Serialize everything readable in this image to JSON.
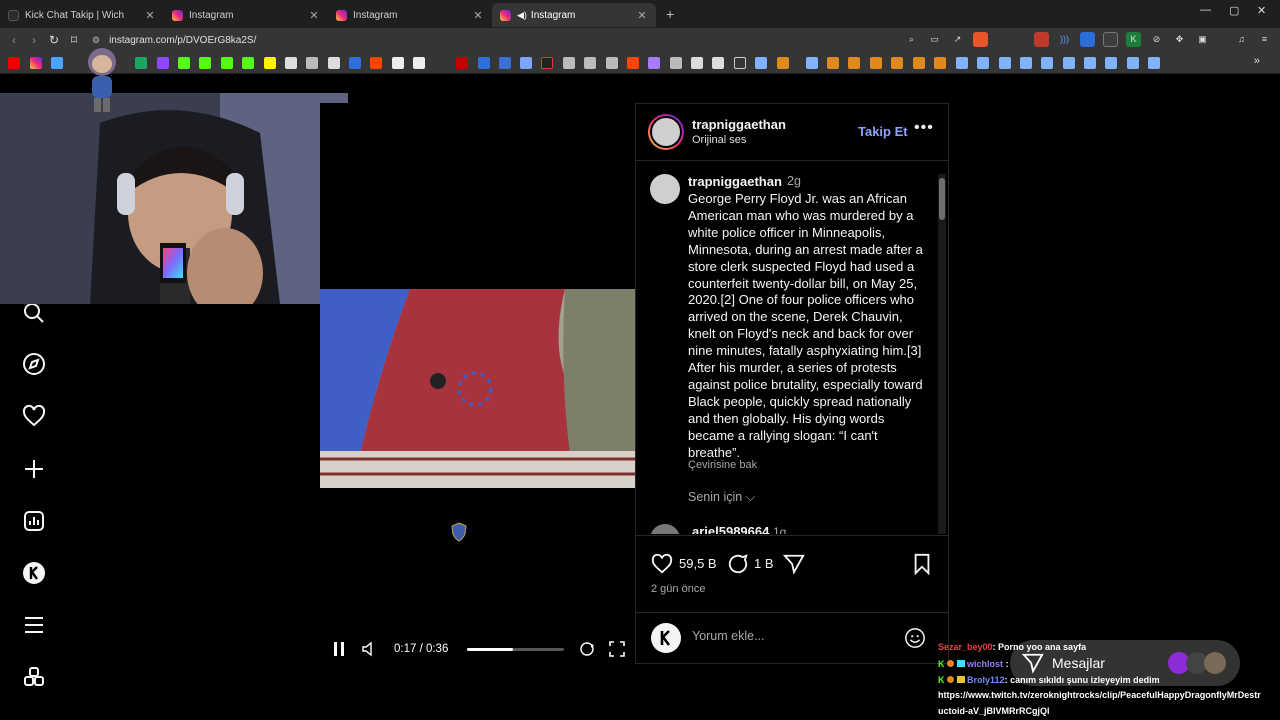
{
  "browser": {
    "tabs": [
      {
        "label": "Kick Chat Takip | Wich",
        "icon": "kick-favicon",
        "active": false
      },
      {
        "label": "Instagram",
        "icon": "instagram-favicon",
        "active": false
      },
      {
        "label": "Instagram",
        "icon": "instagram-favicon",
        "active": false
      },
      {
        "label": "Instagram",
        "icon": "instagram-favicon",
        "active": true,
        "audio": true
      }
    ],
    "url": "instagram.com/p/DVOErG8ka2S/"
  },
  "post": {
    "author": "trapniggaethan",
    "audio": "Orijinal ses",
    "follow_label": "Takip Et",
    "more_label": "•••",
    "caption_time": "2g",
    "caption": "George Perry Floyd Jr. was an African American man who was murdered by a white police officer in Minneapolis, Minnesota, during an arrest made after a store clerk suspected Floyd had used a counterfeit twenty-dollar bill, on May 25, 2020.[2] One of four police officers who arrived on the scene, Derek Chauvin, knelt on Floyd's neck and back for over nine minutes, fatally asphyxiating him.[3] After his murder, a series of protests against police brutality, especially toward Black people, quickly spread nationally and then globally. His dying words became a rallying slogan: “I can't breathe”.",
    "translate_label": "Çevirisine bak",
    "sort_label": "Senin için",
    "next_comment_user": "ariel5989664",
    "next_comment_time": "1g",
    "likes": "59,5 B",
    "comments_count": "1 B",
    "date": "2 gün önce",
    "comment_placeholder": "Yorum ekle..."
  },
  "video": {
    "timecode": "0:17 / 0:36",
    "progress": 0.47
  },
  "chat": {
    "mesajlar_label": "Mesajlar",
    "messages": [
      {
        "user": "Sezar_bey00",
        "text": ": Porno yoo ana sayfa",
        "color": "#e04545"
      },
      {
        "user": "wichlost",
        "text": ":",
        "color": "#9b7bff"
      },
      {
        "user": "Broly112",
        "text": ": canım sıkıldı şunu izleyeyim dedim",
        "color": "#6f8cff"
      }
    ],
    "link_line1": "https://www.twitch.tv/zeroknightrocks/clip/PeacefulHappyDragonflyMrDestr",
    "link_line2": "uctoid-aV_jBIVMRrRCgjQl"
  },
  "colors": {
    "accent_follow": "#8ea2ff",
    "background": "#000000"
  }
}
